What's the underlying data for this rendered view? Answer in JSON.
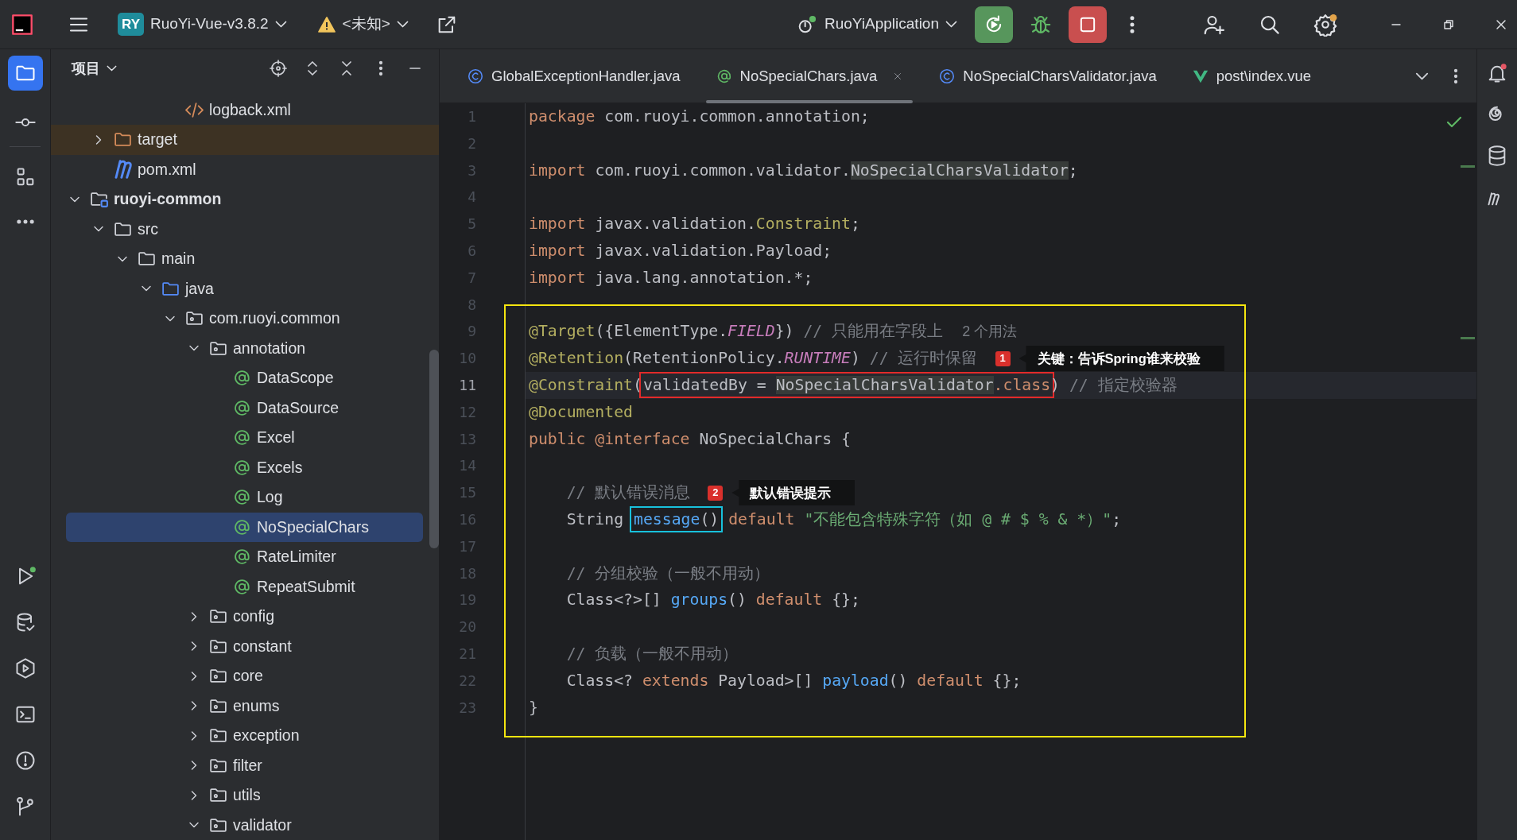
{
  "title_bar": {
    "project_badge": "RY",
    "project": "RuoYi-Vue-v3.8.2",
    "vcs_branch": "<未知>",
    "run_configuration": "RuoYiApplication"
  },
  "project_panel": {
    "title": "项目",
    "tree": [
      {
        "children": [
          {
            "children": [
              {
                "children": [
                  {
                    "children": [
                      {
                        "label": "logback.xml",
                        "kind": "xml",
                        "selected": false
                      }
                    ]
                  }
                ]
              }
            ]
          },
          {
            "label": "target",
            "kind": "excluded-folder",
            "expanded": false,
            "selected": false
          },
          {
            "label": "pom.xml",
            "kind": "maven",
            "selected": false
          }
        ]
      },
      {
        "label": "ruoyi-common",
        "kind": "module",
        "expanded": true,
        "selected": false,
        "children": [
          {
            "label": "src",
            "kind": "folder",
            "expanded": true,
            "selected": false,
            "children": [
              {
                "label": "main",
                "kind": "folder",
                "expanded": true,
                "selected": false,
                "children": [
                  {
                    "label": "java",
                    "kind": "source-folder",
                    "expanded": true,
                    "selected": false,
                    "children": [
                      {
                        "label": "com.ruoyi.common",
                        "kind": "package",
                        "expanded": true,
                        "selected": false,
                        "children": [
                          {
                            "label": "annotation",
                            "kind": "package",
                            "expanded": true,
                            "selected": false,
                            "children": [
                              {
                                "label": "DataScope",
                                "kind": "annotation",
                                "selected": false
                              },
                              {
                                "label": "DataSource",
                                "kind": "annotation",
                                "selected": false
                              },
                              {
                                "label": "Excel",
                                "kind": "annotation",
                                "selected": false
                              },
                              {
                                "label": "Excels",
                                "kind": "annotation",
                                "selected": false
                              },
                              {
                                "label": "Log",
                                "kind": "annotation",
                                "selected": false
                              },
                              {
                                "label": "NoSpecialChars",
                                "kind": "annotation",
                                "selected": true
                              },
                              {
                                "label": "RateLimiter",
                                "kind": "annotation",
                                "selected": false
                              },
                              {
                                "label": "RepeatSubmit",
                                "kind": "annotation",
                                "selected": false
                              }
                            ]
                          },
                          {
                            "label": "config",
                            "kind": "package",
                            "expanded": false,
                            "selected": false
                          },
                          {
                            "label": "constant",
                            "kind": "package",
                            "expanded": false,
                            "selected": false
                          },
                          {
                            "label": "core",
                            "kind": "package",
                            "expanded": false,
                            "selected": false
                          },
                          {
                            "label": "enums",
                            "kind": "package",
                            "expanded": false,
                            "selected": false
                          },
                          {
                            "label": "exception",
                            "kind": "package",
                            "expanded": false,
                            "selected": false
                          },
                          {
                            "label": "filter",
                            "kind": "package",
                            "expanded": false,
                            "selected": false
                          },
                          {
                            "label": "utils",
                            "kind": "package",
                            "expanded": false,
                            "selected": false
                          },
                          {
                            "label": "validator",
                            "kind": "package",
                            "expanded": true,
                            "selected": false
                          }
                        ]
                      }
                    ]
                  }
                ]
              }
            ]
          }
        ]
      }
    ]
  },
  "tabs": [
    {
      "label": "GlobalExceptionHandler.java",
      "kind": "class",
      "selected": false
    },
    {
      "label": "NoSpecialChars.java",
      "kind": "annotation",
      "selected": true
    },
    {
      "label": "NoSpecialCharsValidator.java",
      "kind": "class",
      "selected": false
    },
    {
      "label": "post\\index.vue",
      "kind": "vue",
      "selected": false
    }
  ],
  "editor": {
    "lines": [
      {
        "number": "1",
        "current": false,
        "tokens": [
          {
            "kind": "keyword",
            "text": "package"
          },
          {
            "kind": "plain",
            "text": " com.ruoyi.common.annotation;"
          }
        ]
      },
      {
        "number": "2",
        "current": false
      },
      {
        "number": "3",
        "current": false,
        "tokens": [
          {
            "kind": "keyword",
            "text": "import"
          },
          {
            "kind": "plain",
            "text": " com.ruoyi.common.validator."
          },
          {
            "kind": "usage",
            "text": "NoSpecialCharsValidator"
          },
          {
            "kind": "plain",
            "text": ";"
          }
        ]
      },
      {
        "number": "4",
        "current": false
      },
      {
        "number": "5",
        "current": false,
        "tokens": [
          {
            "kind": "keyword",
            "text": "import"
          },
          {
            "kind": "plain",
            "text": " javax.validation."
          },
          {
            "kind": "annotation",
            "text": "Constraint"
          },
          {
            "kind": "plain",
            "text": ";"
          }
        ]
      },
      {
        "number": "6",
        "current": false,
        "tokens": [
          {
            "kind": "keyword",
            "text": "import"
          },
          {
            "kind": "plain",
            "text": " javax.validation.Payload;"
          }
        ]
      },
      {
        "number": "7",
        "current": false,
        "tokens": [
          {
            "kind": "keyword",
            "text": "import"
          },
          {
            "kind": "plain",
            "text": " java.lang.annotation.*;"
          }
        ]
      }
    ],
    "framed_block": {
      "color": "#f5e50f",
      "lines": [
        {
          "number": "8",
          "current": false
        },
        {
          "number": "9",
          "current": false,
          "tokens": [
            {
              "kind": "annotation",
              "text": "@Target"
            },
            {
              "kind": "plain",
              "text": "({ElementType."
            },
            {
              "kind": "constant",
              "text": "FIELD"
            },
            {
              "kind": "plain",
              "text": "}) "
            },
            {
              "kind": "comment",
              "text": "// 只能用在字段上"
            },
            {
              "kind": "hint",
              "text": "2 个用法"
            }
          ]
        },
        {
          "number": "10",
          "current": false,
          "tokens": [
            {
              "kind": "annotation",
              "text": "@Retention"
            },
            {
              "kind": "plain",
              "text": "(RetentionPolicy."
            },
            {
              "kind": "constant",
              "text": "RUNTIME"
            },
            {
              "kind": "plain",
              "text": ") "
            },
            {
              "kind": "comment",
              "text": "// 运行时保留"
            }
          ],
          "callout": {
            "number": "1",
            "text": "关键：告诉Spring谁来校验"
          }
        },
        {
          "number": "11",
          "current": true,
          "tokens": [
            {
              "kind": "annotation",
              "text": "@Constraint"
            },
            {
              "kind": "plain",
              "text": "("
            },
            {
              "kind": "framed",
              "color": "#e32a2a",
              "tokens": [
                {
                  "kind": "plain",
                  "text": "validatedBy = "
                },
                {
                  "kind": "usage",
                  "text": "NoSpecialCharsValidator"
                },
                {
                  "kind": "keyword",
                  "text": ".class"
                }
              ]
            },
            {
              "kind": "plain",
              "text": ") "
            },
            {
              "kind": "comment",
              "text": "// 指定校验器"
            }
          ]
        },
        {
          "number": "12",
          "current": false,
          "tokens": [
            {
              "kind": "annotation",
              "text": "@Documented"
            }
          ]
        },
        {
          "number": "13",
          "current": false,
          "tokens": [
            {
              "kind": "keyword",
              "text": "public @interface"
            },
            {
              "kind": "plain",
              "text": " NoSpecialChars {"
            }
          ]
        },
        {
          "number": "14",
          "current": false
        },
        {
          "number": "15",
          "current": false,
          "tokens": [
            {
              "kind": "comment",
              "text": "    // 默认错误消息"
            }
          ],
          "callout": {
            "number": "2",
            "text": "默认错误提示"
          }
        },
        {
          "number": "16",
          "current": false,
          "tokens": [
            {
              "kind": "plain",
              "text": "    String "
            },
            {
              "kind": "framed",
              "color": "#18c1dc",
              "tokens": [
                {
                  "kind": "declaration",
                  "text": "message"
                },
                {
                  "kind": "plain",
                  "text": "()"
                }
              ]
            },
            {
              "kind": "keyword",
              "text": " default"
            },
            {
              "kind": "string",
              "text": " \"不能包含特殊字符（如 @ # $ % & *）\""
            },
            {
              "kind": "plain",
              "text": ";"
            }
          ]
        },
        {
          "number": "17",
          "current": false
        },
        {
          "number": "18",
          "current": false,
          "tokens": [
            {
              "kind": "comment",
              "text": "    // 分组校验（一般不用动）"
            }
          ]
        },
        {
          "number": "19",
          "current": false,
          "tokens": [
            {
              "kind": "plain",
              "text": "    Class<?>[] "
            },
            {
              "kind": "declaration",
              "text": "groups"
            },
            {
              "kind": "plain",
              "text": "() "
            },
            {
              "kind": "keyword",
              "text": "default"
            },
            {
              "kind": "plain",
              "text": " {};"
            }
          ]
        },
        {
          "number": "20",
          "current": false
        },
        {
          "number": "21",
          "current": false,
          "tokens": [
            {
              "kind": "comment",
              "text": "    // 负载（一般不用动）"
            }
          ]
        },
        {
          "number": "22",
          "current": false,
          "tokens": [
            {
              "kind": "plain",
              "text": "    Class<? "
            },
            {
              "kind": "keyword",
              "text": "extends"
            },
            {
              "kind": "plain",
              "text": " Payload>[] "
            },
            {
              "kind": "declaration",
              "text": "payload"
            },
            {
              "kind": "plain",
              "text": "() "
            },
            {
              "kind": "keyword",
              "text": "default"
            },
            {
              "kind": "plain",
              "text": " {};"
            }
          ]
        },
        {
          "number": "23",
          "current": false,
          "tokens": [
            {
              "kind": "plain",
              "text": "}"
            }
          ]
        }
      ]
    }
  }
}
